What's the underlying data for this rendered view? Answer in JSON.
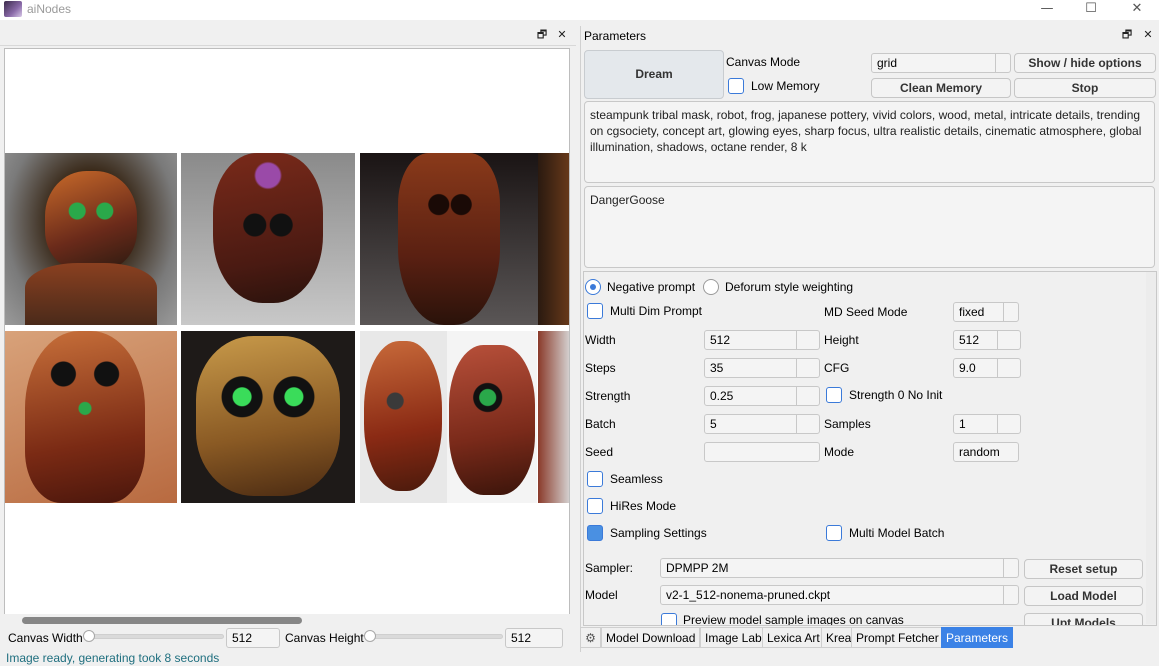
{
  "window": {
    "title": "aiNodes",
    "min": "—",
    "max": "☐",
    "close": "✕"
  },
  "left_dock": {
    "restore": "🗗",
    "close": "✕"
  },
  "bottom": {
    "canvas_width_label": "Canvas Width",
    "canvas_width_value": "512",
    "canvas_height_label": "Canvas Height",
    "canvas_height_value": "512"
  },
  "status": "Image ready, generating took 8 seconds",
  "parameters": {
    "title": "Parameters",
    "restore": "🗗",
    "close": "✕",
    "dream_button": "Dream",
    "canvas_mode_label": "Canvas Mode",
    "canvas_mode_value": "grid",
    "show_hide_button": "Show / hide options",
    "low_memory_label": "Low Memory",
    "clean_memory_button": "Clean Memory",
    "stop_button": "Stop",
    "prompt": "steampunk tribal mask, robot, frog, japanese pottery, vivid colors, wood, metal, intricate details, trending on cgsociety, concept art, glowing eyes, sharp focus, ultra realistic details, cinematic atmosphere, global illumination, shadows, octane render, 8 k",
    "negative": "DangerGoose",
    "negative_prompt_radio": "Negative prompt",
    "deforum_radio": "Deforum style weighting",
    "multi_dim_prompt": "Multi Dim Prompt",
    "md_seed_mode_label": "MD Seed Mode",
    "md_seed_mode_value": "fixed",
    "width_label": "Width",
    "width_value": "512",
    "height_label": "Height",
    "height_value": "512",
    "steps_label": "Steps",
    "steps_value": "35",
    "cfg_label": "CFG",
    "cfg_value": "9.0",
    "strength_label": "Strength",
    "strength_value": "0.25",
    "strength0_label": "Strength 0 No Init",
    "batch_label": "Batch",
    "batch_value": "5",
    "samples_label": "Samples",
    "samples_value": "1",
    "seed_label": "Seed",
    "seed_value": "",
    "mode_label": "Mode",
    "mode_value": "random",
    "seamless": "Seamless",
    "hires": "HiRes Mode",
    "sampling_settings": "Sampling Settings",
    "multi_model_batch": "Multi Model Batch",
    "sampler_label": "Sampler:",
    "sampler_value": "DPMPP 2M",
    "reset_setup_button": "Reset setup",
    "model_label": "Model",
    "model_value": "v2-1_512-nonema-pruned.ckpt",
    "load_model_button": "Load Model",
    "preview_label": "Preview model sample images on canvas",
    "upd_models_button": "Upt Models"
  },
  "tabs": [
    "Model Download",
    "Image Lab",
    "Lexica Art",
    "Krea",
    "Prompt Fetcher",
    "Parameters"
  ],
  "settings_tab_icon": "gear-icon",
  "colors": {
    "accent": "#3b82e6",
    "status_text": "#1f6f7f"
  }
}
